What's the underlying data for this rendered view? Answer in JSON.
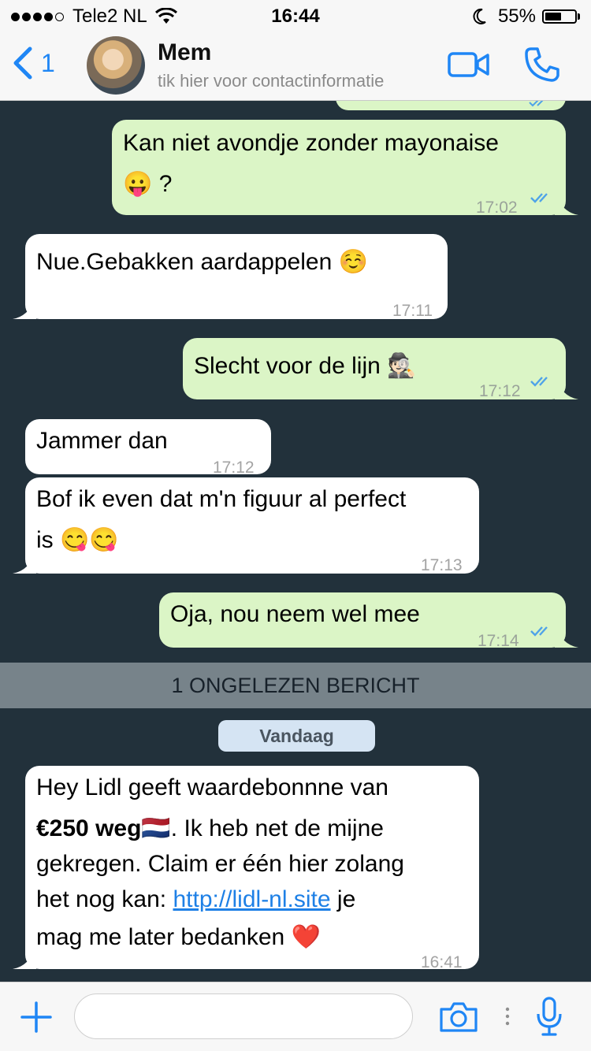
{
  "status_bar": {
    "carrier": "Tele2 NL",
    "time": "16:44",
    "battery": "55%",
    "battery_level": 0.55,
    "signal_bars": 4
  },
  "header": {
    "back_count": "1",
    "contact_name": "Mem",
    "contact_subtitle": "tik hier voor contactinformatie",
    "icons": [
      "back-chevron-icon",
      "video-call-icon",
      "phone-icon"
    ]
  },
  "messages": [
    {
      "dir": "out",
      "text": "Kan niet avondje zonder mayonaise",
      "text2": "😛 ?",
      "time": "17:02",
      "read": true
    },
    {
      "dir": "in",
      "text": "Nue.Gebakken aardappelen ☺️",
      "time": "17:11"
    },
    {
      "dir": "out",
      "text": "Slecht voor de lijn 🕵🏻",
      "time": "17:12",
      "read": true
    },
    {
      "dir": "in",
      "text": "Jammer dan",
      "time": "17:12"
    },
    {
      "dir": "in",
      "text": "Bof ik even dat m'n figuur al perfect",
      "text2": "is 😋😋",
      "time": "17:13"
    },
    {
      "dir": "out",
      "text": "Oja, nou neem wel mee",
      "time": "17:14",
      "read": true
    }
  ],
  "unread_banner": "1 ONGELEZEN BERICHT",
  "date_label": "Vandaag",
  "last_message": {
    "line1": "Hey Lidl geeft waardebonnne van",
    "bold": "€250 weg🇳🇱",
    "line2_rest": ". Ik heb net de mijne",
    "line3": "gekregen. Claim er één hier zolang",
    "line4_pre": "het nog kan: ",
    "link": "http://lidl-nl.site",
    "line4_post": " je",
    "line5": "mag me later bedanken ❤️",
    "time": "16:41"
  },
  "input_bar": {
    "placeholder": "",
    "icons": [
      "plus-icon",
      "camera-icon",
      "microphone-icon"
    ]
  },
  "colors": {
    "accent": "#1f86f5",
    "outgoing_bubble": "#dbf5c6",
    "incoming_bubble": "#ffffff",
    "chat_background": "#22313b",
    "read_ticks": "#4fa3e8"
  }
}
